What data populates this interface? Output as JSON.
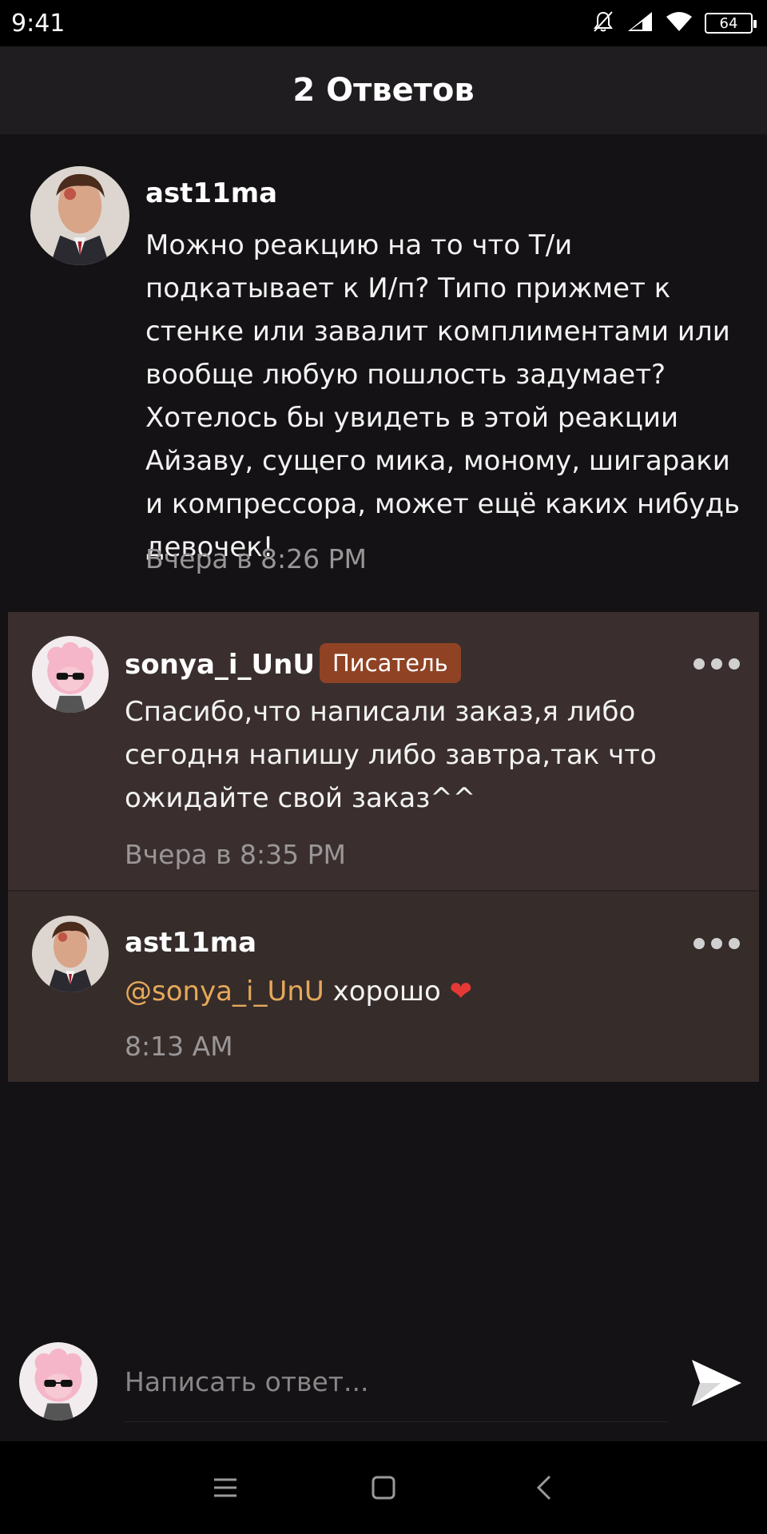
{
  "status_bar": {
    "time": "9:41",
    "battery": "64"
  },
  "header": {
    "title": "2 Ответов"
  },
  "comment": {
    "author": "ast11ma",
    "text": "Можно реакцию на то что Т/и подкатывает к И/п? Типо прижмет к стенке или завалит комплиментами или вообще любую пошлость задумает? Хотелось бы увидеть в этой реакции Айзаву, сущего мика, моному, шигараки и компрессора, может ещё каких нибудь девочек!",
    "time": "Вчера в 8:26 PM"
  },
  "replies": [
    {
      "author": "sonya_i_UnU",
      "badge": "Писатель",
      "text": "Спасибо,что написали заказ,я либо сегодня напишу либо завтра,так что ожидайте свой заказ^^",
      "time": "Вчера в 8:35 PM"
    },
    {
      "author": "ast11ma",
      "mention": "@sonya_i_UnU",
      "text": "хорошо",
      "emoji": "❤",
      "time": "8:13 AM"
    }
  ],
  "composer": {
    "placeholder": "Написать ответ..."
  },
  "icons": {
    "status": [
      "bell-muted-icon",
      "signal-icon",
      "wifi-icon",
      "battery-icon"
    ],
    "more": "more-dots-icon",
    "send": "send-icon",
    "nav": [
      "menu-icon",
      "home-icon",
      "back-icon"
    ]
  },
  "colors": {
    "background": "#141214",
    "header": "#1f1d1f",
    "reply_highlight": "#3a2f2e",
    "badge": "#8f4324",
    "mention": "#e6a95a",
    "heart": "#e53935"
  }
}
